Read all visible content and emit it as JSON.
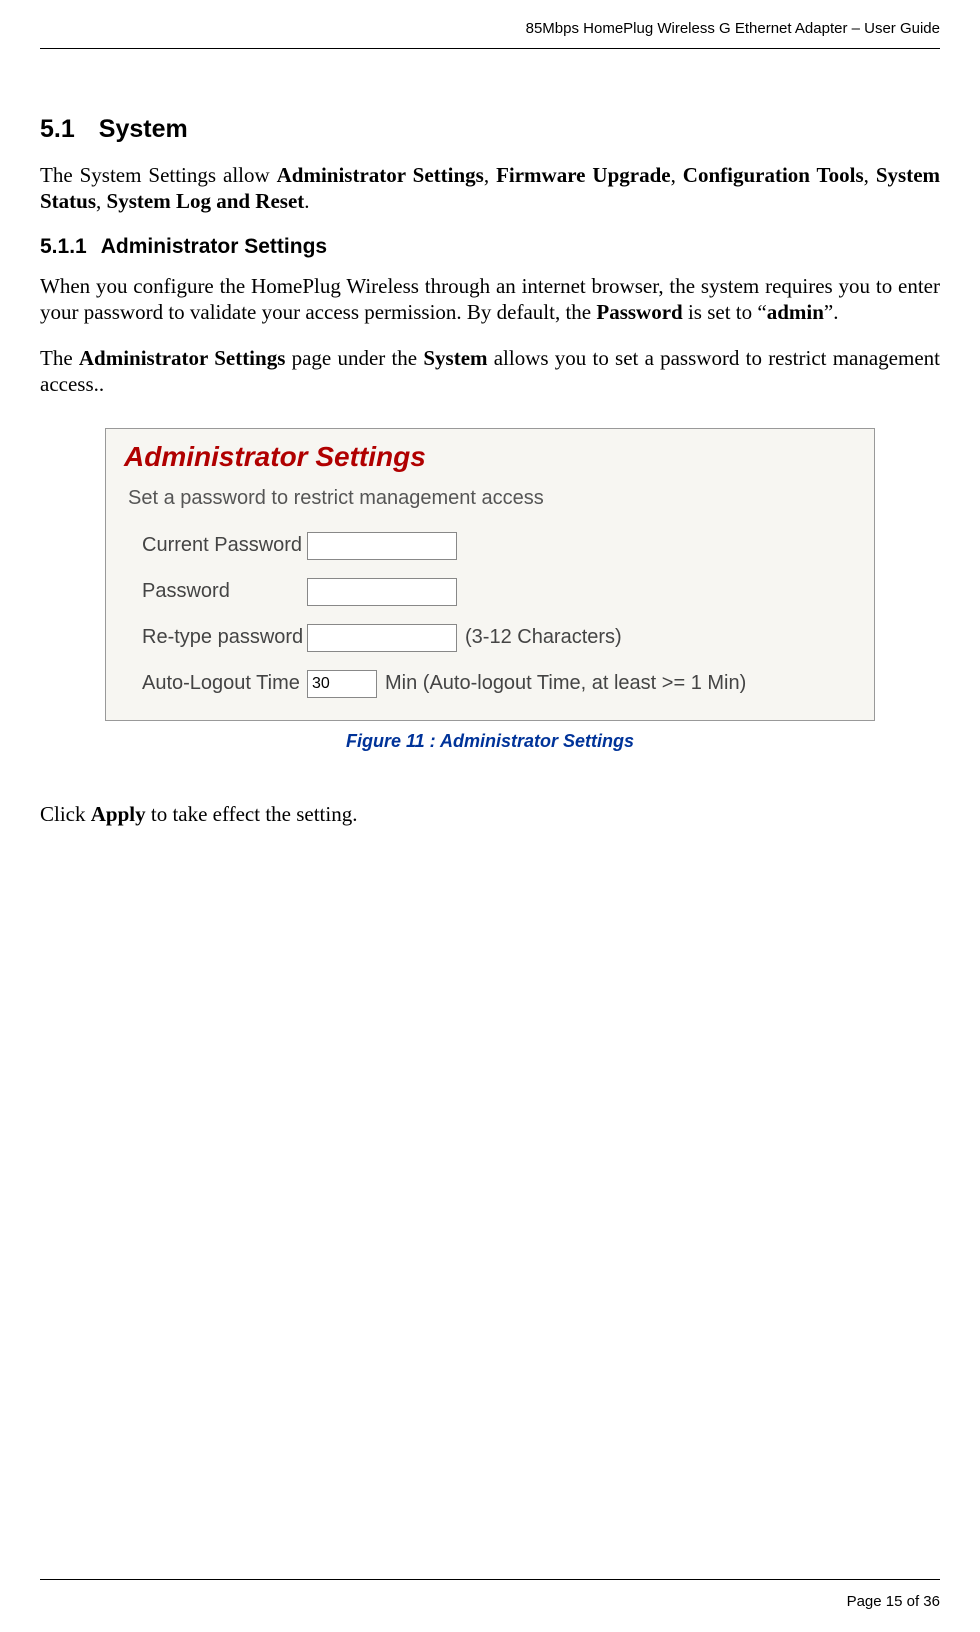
{
  "header": {
    "doc_title": "85Mbps HomePlug Wireless G Ethernet Adapter – User Guide"
  },
  "section": {
    "number": "5.1",
    "title": "System",
    "intro_prefix": "The System Settings allow ",
    "intro_bold1": "Administrator Settings",
    "intro_sep1": ", ",
    "intro_bold2": "Firmware Upgrade",
    "intro_sep2": ", ",
    "intro_bold3": "Configuration Tools",
    "intro_sep3": ", ",
    "intro_bold4": "System Status",
    "intro_sep4": ", ",
    "intro_bold5": "System Log and Reset",
    "intro_suffix": "."
  },
  "subsection": {
    "number": "5.1.1",
    "title": "Administrator Settings",
    "para1_pre": "When you configure the HomePlug Wireless through an internet browser, the system requires you to enter your password to validate your access permission. By default, the ",
    "para1_bold1": "Password",
    "para1_mid1": "  is set to “",
    "para1_bold2": "admin",
    "para1_suffix": "”.",
    "para2_pre": "The ",
    "para2_bold1": "Administrator Settings",
    "para2_mid1": " page under the ",
    "para2_bold2": "System",
    "para2_suffix": " allows you to set a password to restrict management access.."
  },
  "panel": {
    "title": "Administrator Settings",
    "description": "Set a password to restrict management access",
    "rows": {
      "current_password_label": "Current Password",
      "password_label": "Password",
      "retype_label": "Re-type password",
      "retype_hint": "(3-12 Characters)",
      "autologout_label": "Auto-Logout Time",
      "autologout_value": "30",
      "autologout_hint": "Min (Auto-logout Time, at least >= 1 Min)"
    }
  },
  "figure_caption": "Figure 11 : Administrator Settings",
  "apply": {
    "pre": "Click ",
    "bold": "Apply",
    "suffix": " to take effect the setting."
  },
  "footer": {
    "page": "Page 15 of 36"
  }
}
